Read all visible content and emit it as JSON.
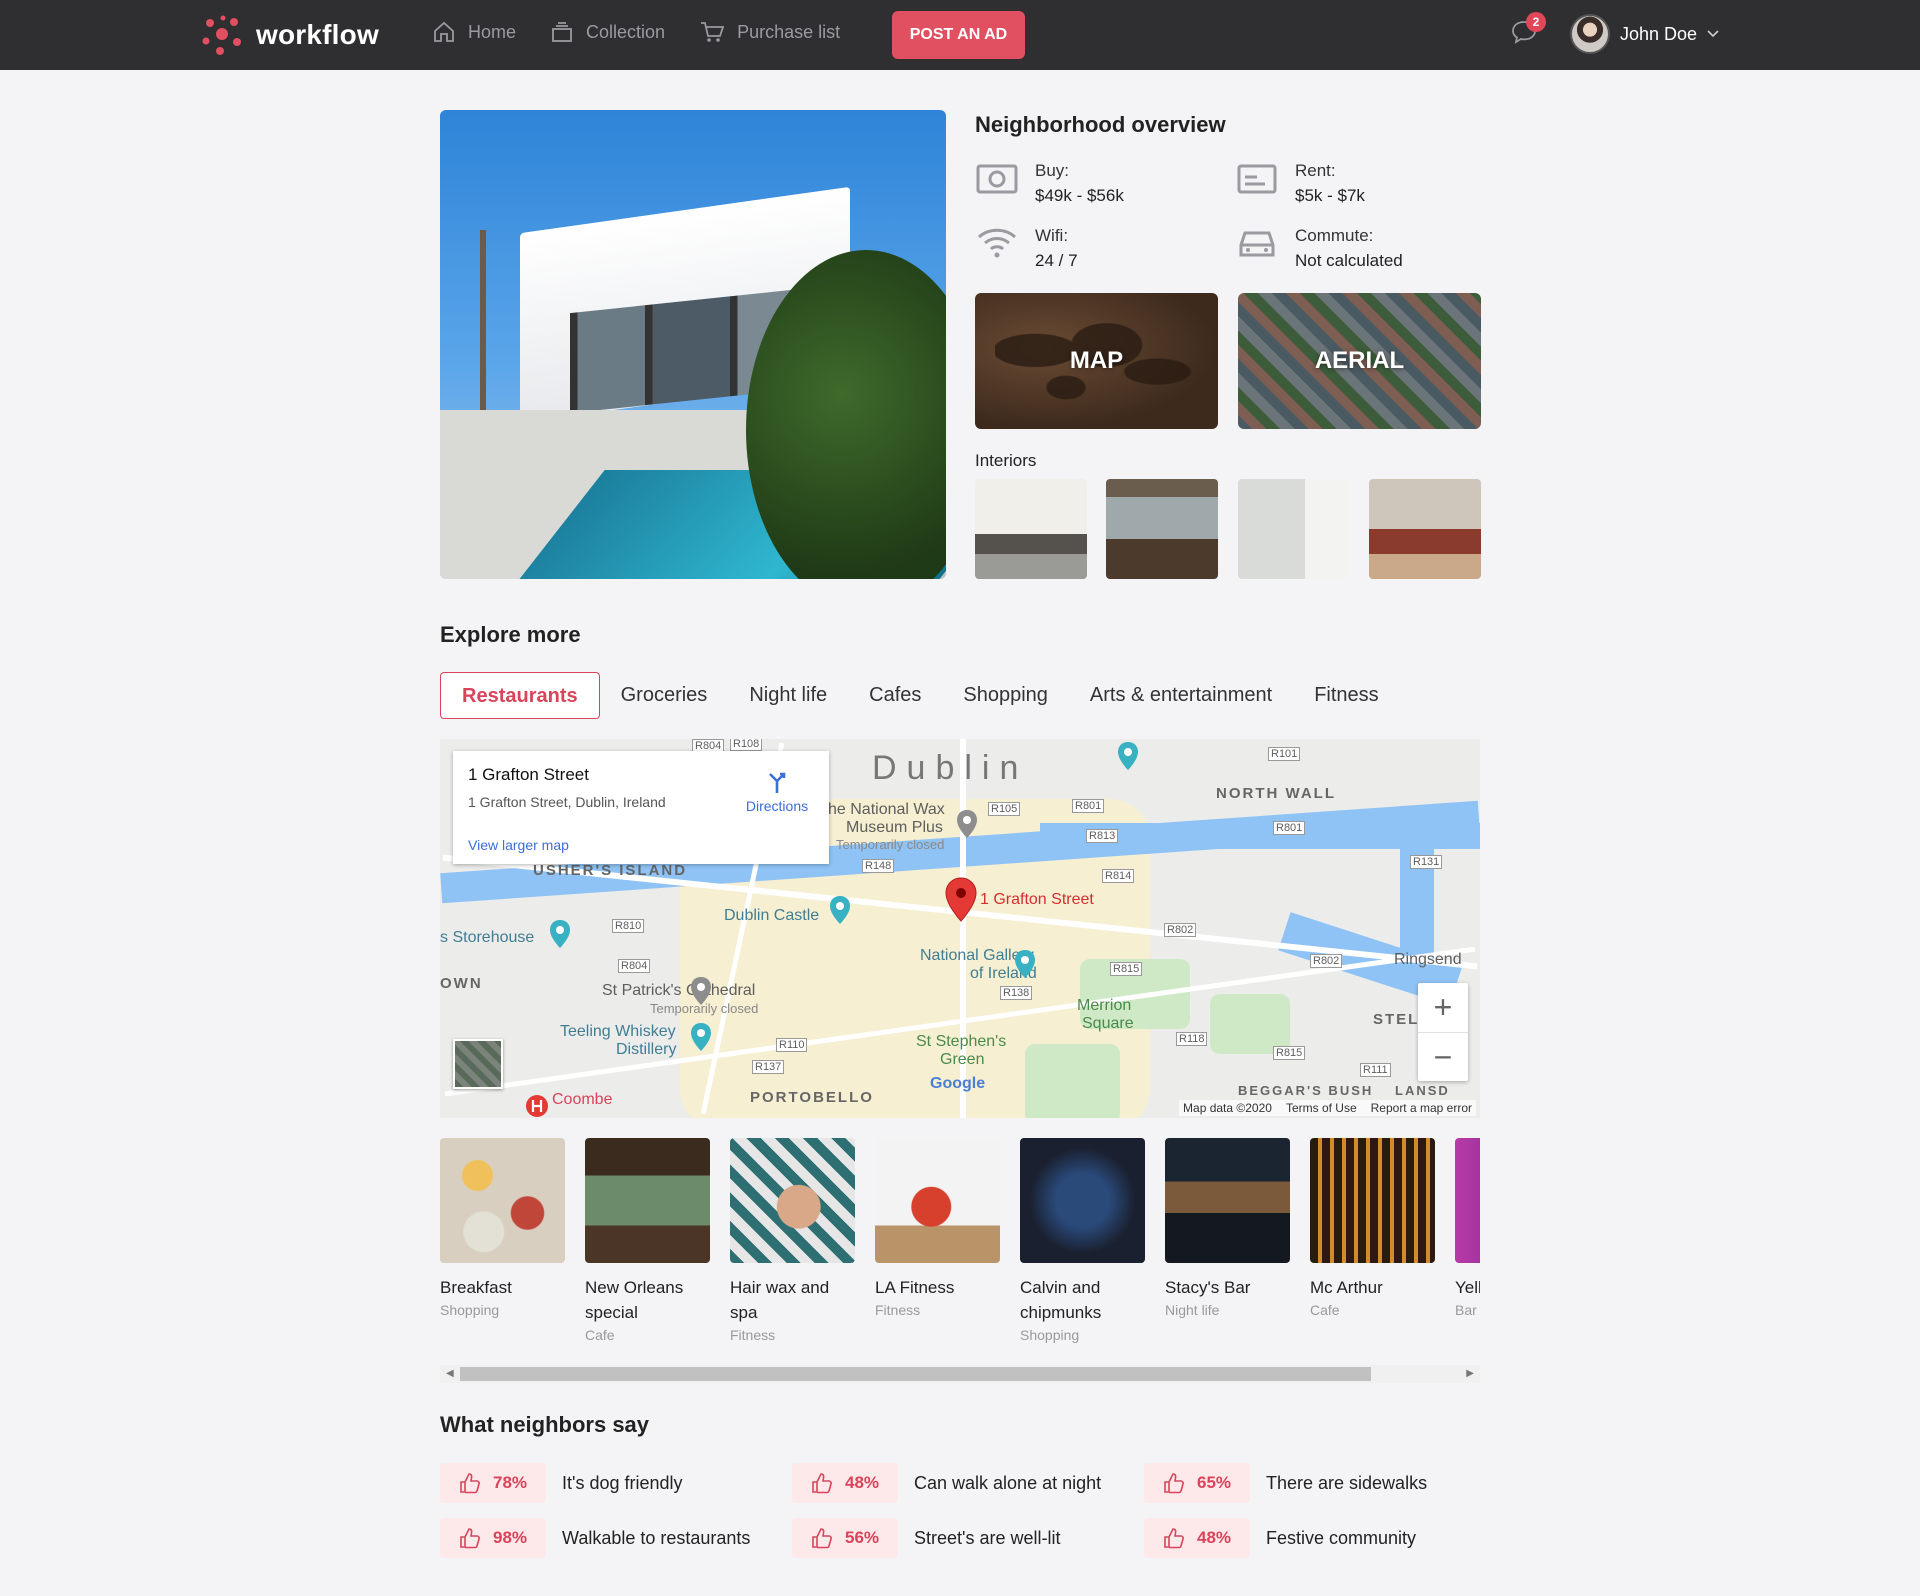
{
  "brand": {
    "name": "workflow",
    "accent": "#e05060"
  },
  "nav": {
    "items": [
      {
        "label": "Home",
        "icon": "home-icon"
      },
      {
        "label": "Collection",
        "icon": "collection-icon"
      },
      {
        "label": "Purchase list",
        "icon": "cart-icon"
      }
    ],
    "post_button": "POST AN AD",
    "notifications": "2",
    "user": "John Doe"
  },
  "overview": {
    "title": "Neighborhood overview",
    "items": [
      {
        "label": "Buy:",
        "value": "$49k - $56k",
        "icon": "money-icon"
      },
      {
        "label": "Rent:",
        "value": "$5k - $7k",
        "icon": "id-card-icon"
      },
      {
        "label": "Wifi:",
        "value": "24 / 7",
        "icon": "wifi-icon"
      },
      {
        "label": "Commute:",
        "value": "Not calculated",
        "icon": "car-icon"
      }
    ],
    "tiles": [
      "MAP",
      "AERIAL"
    ],
    "interiors_label": "Interiors"
  },
  "explore": {
    "title": "Explore more",
    "tabs": [
      "Restaurants",
      "Groceries",
      "Night life",
      "Cafes",
      "Shopping",
      "Arts & entertainment",
      "Fitness"
    ],
    "active_tab": "Restaurants"
  },
  "map": {
    "info_title": "1 Grafton Street",
    "info_address": "1 Grafton Street, Dublin, Ireland",
    "info_link": "View larger map",
    "directions": "Directions",
    "pin_label": "1 Grafton Street",
    "labels": {
      "city": "Dublin",
      "north_wall": "NORTH WALL",
      "usher": "USHER'S ISLAND",
      "wax1": "he National Wax",
      "wax2": "Museum Plus",
      "closed": "Temporarily closed",
      "castle": "Dublin Castle",
      "storehouse": "s Storehouse",
      "own": "OWN",
      "patrick": "St Patrick's Cathedral",
      "patrick_closed": "Temporarily closed",
      "gallery1": "National Gallery",
      "gallery2": "of Ireland",
      "merrion1": "Merrion",
      "merrion2": "Square",
      "ringsend": "Ringsend",
      "stel": "STEL",
      "teeling1": "Teeling Whiskey",
      "teeling2": "Distillery",
      "stephens1": "St Stephen's",
      "stephens2": "Green",
      "portobello": "PORTOBELLO",
      "beggars": "BEGGAR'S BUSH",
      "lansd": "LANSD",
      "coombe": "Coombe",
      "google": "Google"
    },
    "roads": [
      "R804",
      "R108",
      "R101",
      "R105",
      "R801",
      "R813",
      "R801",
      "R131",
      "R148",
      "R814",
      "R810",
      "R802",
      "R804",
      "R815",
      "R802",
      "R138",
      "R118",
      "R110",
      "R815",
      "R137",
      "R111"
    ],
    "footer": [
      "Map data ©2020",
      "Terms of Use",
      "Report a map error"
    ]
  },
  "places": [
    {
      "name": "Breakfast",
      "category": "Shopping"
    },
    {
      "name": "New Orleans special",
      "category": "Cafe"
    },
    {
      "name": "Hair wax and spa",
      "category": "Fitness"
    },
    {
      "name": "LA Fitness",
      "category": "Fitness"
    },
    {
      "name": "Calvin and chipmunks",
      "category": "Shopping"
    },
    {
      "name": "Stacy's Bar",
      "category": "Night life"
    },
    {
      "name": "Mc Arthur",
      "category": "Cafe"
    },
    {
      "name": "Yell",
      "category": "Bar"
    }
  ],
  "neighbors": {
    "title": "What neighbors say",
    "items": [
      {
        "percent": "78%",
        "text": "It's dog friendly"
      },
      {
        "percent": "48%",
        "text": "Can walk alone at night"
      },
      {
        "percent": "65%",
        "text": "There are sidewalks"
      },
      {
        "percent": "98%",
        "text": "Walkable to restaurants"
      },
      {
        "percent": "56%",
        "text": "Street's are well-lit"
      },
      {
        "percent": "48%",
        "text": "Festive community"
      }
    ]
  }
}
